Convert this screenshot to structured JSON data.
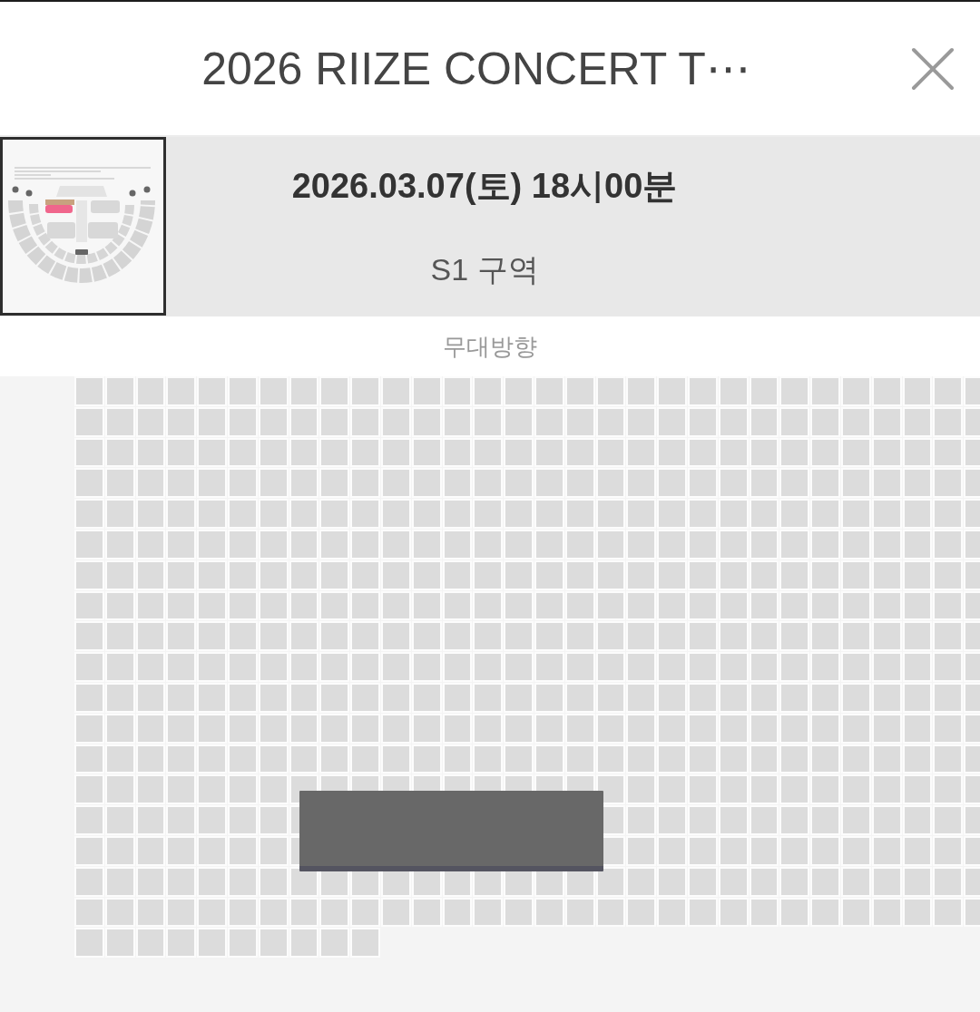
{
  "header": {
    "title": "2026 RIIZE CONCERT T⋯"
  },
  "performance": {
    "datetime": "2026.03.07(토) 18시00분",
    "section": "S1 구역"
  },
  "stage_direction": "무대방향"
}
